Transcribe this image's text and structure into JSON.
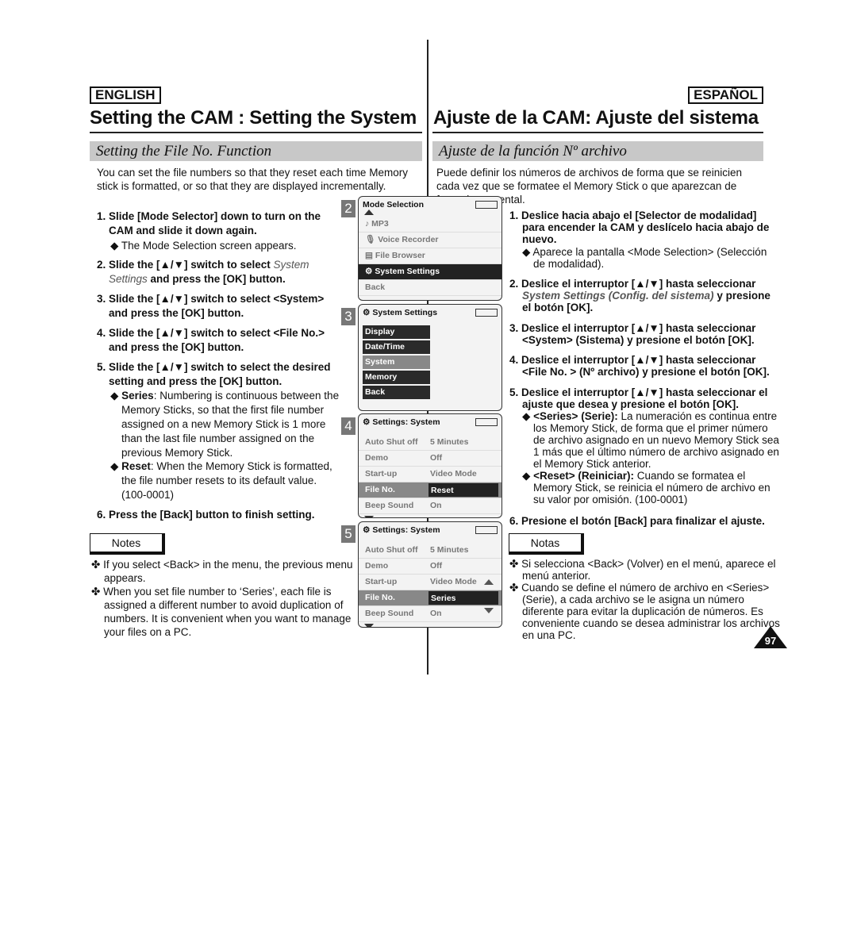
{
  "header": {
    "lang_en": "ENGLISH",
    "lang_es": "ESPAÑOL",
    "title_en": "Setting the CAM : Setting the System",
    "title_es": "Ajuste de la CAM: Ajuste del sistema"
  },
  "en": {
    "section": "Setting the File No. Function",
    "intro": "You can set the file numbers so that they reset each time Memory stick is formatted, or so that they are displayed incrementally.",
    "s1": "1. Slide [Mode Selector] down to turn on the CAM and slide it down again.",
    "s1a": "◆ The Mode Selection screen appears.",
    "s2a": "2. Slide the [▲/▼] switch to select ",
    "s2i": "System Settings",
    "s2b": " and press the [OK] button.",
    "s3": "3. Slide the [▲/▼] switch to select <System> and press the [OK] button.",
    "s4": "4. Slide the [▲/▼] switch to select <File No.> and press the [OK] button.",
    "s5": "5. Slide the [▲/▼] switch to select the desired setting and press the [OK] button.",
    "series_k": "Series",
    "series_t": ": Numbering is continuous between the Memory Sticks, so that the first file number assigned on a new Memory Stick is 1 more than the last file number assigned on the previous Memory Stick.",
    "reset_k": "Reset",
    "reset_t": ": When the Memory Stick is formatted, the file number resets to its default value. (100-0001)",
    "s6": "6. Press the [Back] button to finish setting.",
    "notes": "Notes",
    "n1": "If you select <Back> in the menu, the previous menu appears.",
    "n2": "When you set file number to ‘Series’, each file is assigned a different number to avoid duplication of numbers. It is convenient when you want to manage your files on a PC."
  },
  "es": {
    "section": "Ajuste de la función Nº archivo",
    "intro": "Puede definir los números de archivos de forma que se reinicien cada vez que se formatee el Memory Stick o que aparezcan de forma incremental.",
    "s1": "1. Deslice hacia abajo el [Selector de modalidad] para encender la CAM y deslícelo hacia abajo de nuevo.",
    "s1a": "◆ Aparece la pantalla <Mode Selection> (Selección de modalidad).",
    "s2a": "2. Deslice el interruptor [▲/▼] hasta seleccionar ",
    "s2i": "System Settings (Config. del sistema)",
    "s2b": " y presione el botón [OK].",
    "s3": "3. Deslice el interruptor [▲/▼] hasta seleccionar <System> (Sistema) y presione el botón [OK].",
    "s4": "4. Deslice el interruptor [▲/▼] hasta seleccionar <File No. > (Nº archivo) y presione el botón [OK].",
    "s5": "5. Deslice el interruptor [▲/▼] hasta seleccionar el ajuste que desea y presione el botón [OK].",
    "series_k": "<Series> (Serie):",
    "series_t": " La numeración es continua entre los Memory Stick, de forma que el primer número de archivo asignado en un nuevo Memory Stick sea 1 más que el último número de archivo asignado en el Memory Stick anterior.",
    "reset_k": "<Reset> (Reiniciar):",
    "reset_t": " Cuando se formatea el Memory Stick, se reinicia el número de archivo en su valor por omisión. (100-0001)",
    "s6": "6. Presione el botón [Back] para finalizar el ajuste.",
    "notes": "Notas",
    "n1": "Si selecciona <Back> (Volver) en el menú, aparece el menú anterior.",
    "n2": "Cuando se define el número de archivo en <Series> (Serie), a cada archivo se le asigna un número diferente para evitar la duplicación de números. Es conveniente cuando se desea administrar los archivos en una PC."
  },
  "screens": {
    "s2": {
      "num": "2",
      "title": "Mode Selection",
      "items": [
        "MP3",
        "Voice Recorder",
        "File Browser",
        "System Settings",
        "Back"
      ]
    },
    "s3": {
      "num": "3",
      "title": "System Settings",
      "items": [
        "Display",
        "Date/Time",
        "System",
        "Memory",
        "Back"
      ]
    },
    "s4": {
      "num": "4",
      "title": "Settings: System",
      "rows": [
        [
          "Auto Shut off",
          "5 Minutes"
        ],
        [
          "Demo",
          "Off"
        ],
        [
          "Start-up",
          "Video Mode"
        ],
        [
          "File No.",
          "Reset"
        ],
        [
          "Beep Sound",
          "On"
        ]
      ]
    },
    "s5": {
      "num": "5",
      "title": "Settings: System",
      "rows": [
        [
          "Auto Shut off",
          "5 Minutes"
        ],
        [
          "Demo",
          "Off"
        ],
        [
          "Start-up",
          "Video Mode"
        ],
        [
          "File No.",
          "Series"
        ],
        [
          "Beep Sound",
          "On"
        ]
      ]
    }
  },
  "page_number": "97",
  "note_bullet": "✤"
}
